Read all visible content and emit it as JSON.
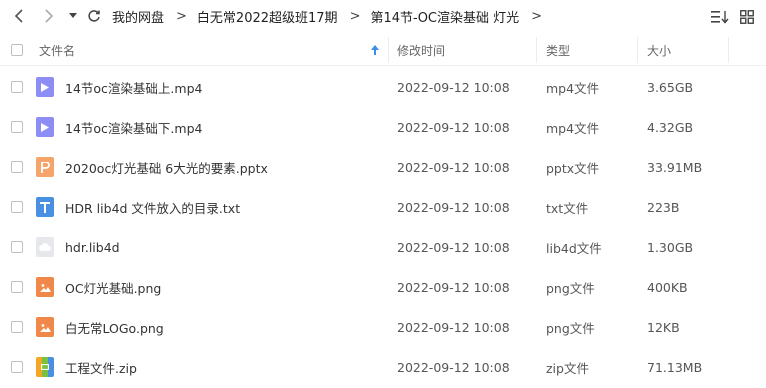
{
  "toolbar": {
    "back_icon": "chevron-left-icon",
    "forward_icon": "chevron-right-icon",
    "history_icon": "caret-down-icon",
    "refresh_icon": "refresh-icon",
    "sort_icon": "sort-list-icon",
    "grid_icon": "grid-view-icon"
  },
  "breadcrumb": [
    "我的网盘",
    "白无常2022超级班17期",
    "第14节-OC渲染基础 灯光"
  ],
  "breadcrumb_separator": ">",
  "columns": {
    "name": "文件名",
    "modified": "修改时间",
    "type": "类型",
    "size": "大小"
  },
  "sort_indicator": "arrow-up-icon",
  "files": [
    {
      "name": "14节oc渲染基础上.mp4",
      "modified": "2022-09-12 10:08",
      "type": "mp4文件",
      "size": "3.65GB",
      "icon": "video-file-icon",
      "color": "#8c8ef5"
    },
    {
      "name": "14节oc渲染基础下.mp4",
      "modified": "2022-09-12 10:08",
      "type": "mp4文件",
      "size": "4.32GB",
      "icon": "video-file-icon",
      "color": "#8c8ef5"
    },
    {
      "name": "2020oc灯光基础 6大光的要素.pptx",
      "modified": "2022-09-12 10:08",
      "type": "pptx文件",
      "size": "33.91MB",
      "icon": "pptx-file-icon",
      "color": "#f5a46b"
    },
    {
      "name": "HDR lib4d 文件放入的目录.txt",
      "modified": "2022-09-12 10:08",
      "type": "txt文件",
      "size": "223B",
      "icon": "text-file-icon",
      "color": "#4a90e2"
    },
    {
      "name": "hdr.lib4d",
      "modified": "2022-09-12 10:08",
      "type": "lib4d文件",
      "size": "1.30GB",
      "icon": "unknown-file-icon",
      "color": "#d3d6db"
    },
    {
      "name": "OC灯光基础.png",
      "modified": "2022-09-12 10:08",
      "type": "png文件",
      "size": "400KB",
      "icon": "image-file-icon",
      "color": "#f0884a"
    },
    {
      "name": "白无常LOGo.png",
      "modified": "2022-09-12 10:08",
      "type": "png文件",
      "size": "12KB",
      "icon": "image-file-icon",
      "color": "#f0884a"
    },
    {
      "name": "工程文件.zip",
      "modified": "2022-09-12 10:08",
      "type": "zip文件",
      "size": "71.13MB",
      "icon": "zip-file-icon",
      "color": "#7ac142"
    }
  ]
}
